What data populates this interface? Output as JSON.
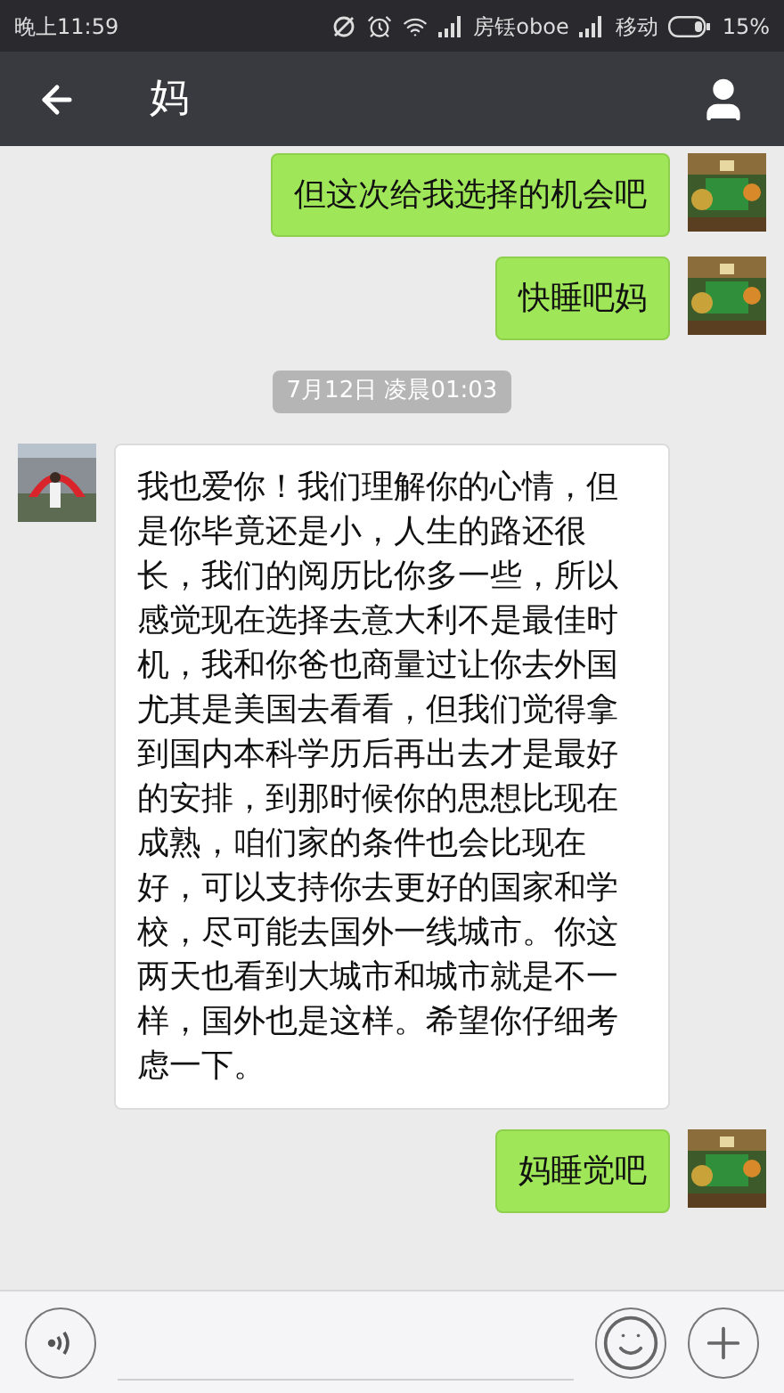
{
  "status_bar": {
    "time": "晚上11:59",
    "carrier_1": "房铥oboe",
    "carrier_2": "移动",
    "battery": "15%"
  },
  "header": {
    "title": "妈"
  },
  "messages": [
    {
      "kind": "sent",
      "text": "但这次给我选择的机会吧"
    },
    {
      "kind": "sent",
      "text": "快睡吧妈"
    },
    {
      "kind": "time",
      "text": "7月12日 凌晨01:03"
    },
    {
      "kind": "received",
      "text": "我也爱你！我们理解你的心情，但是你毕竟还是小，人生的路还很长，我们的阅历比你多一些，所以感觉现在选择去意大利不是最佳时机，我和你爸也商量过让你去外国尤其是美国去看看，但我们觉得拿到国内本科学历后再出去才是最好的安排，到那时候你的思想比现在成熟，咱们家的条件也会比现在好，可以支持你去更好的国家和学校，尽可能去国外一线城市。你这两天也看到大城市和城市就是不一样，国外也是这样。希望你仔细考虑一下。"
    },
    {
      "kind": "sent",
      "text": "妈睡觉吧"
    }
  ]
}
